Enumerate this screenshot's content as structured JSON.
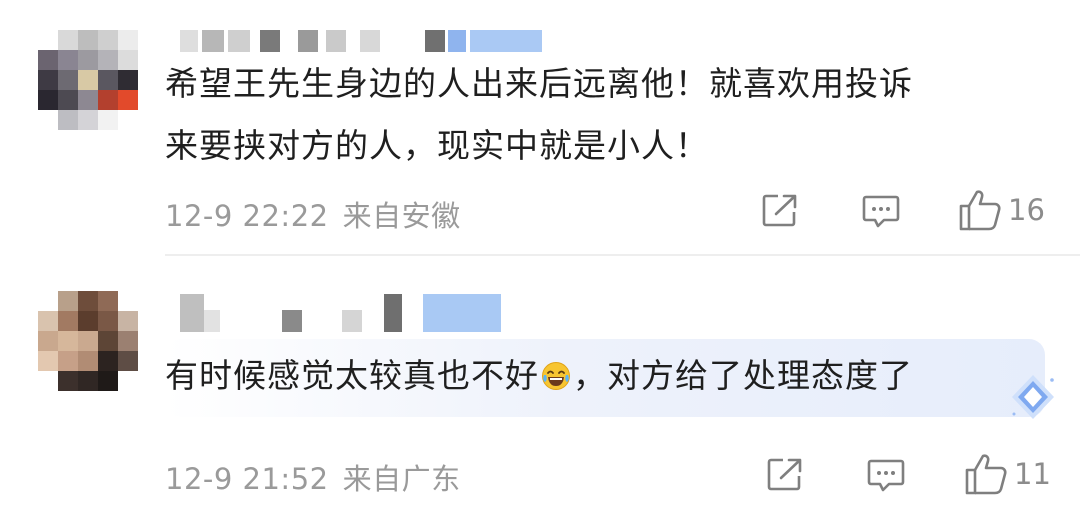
{
  "comments": [
    {
      "text_line1": "希望王先生身边的人出来后远离他！就喜欢用投诉",
      "text_line2": "来要挟对方的人，现实中就是小人！",
      "date": "12-9 22:22",
      "location": "来自安徽",
      "likes": "16",
      "share_icon": "share-icon",
      "comment_icon": "comment-icon",
      "like_icon": "thumbs-up-icon"
    },
    {
      "text_part1": "有时候感觉太较真也不好",
      "emoji": "laugh-cry-emoji",
      "text_part2": "，对方给了处理态度了",
      "date": "12-9 21:52",
      "location": "来自广东",
      "likes": "11",
      "share_icon": "share-icon",
      "comment_icon": "comment-icon",
      "like_icon": "thumbs-up-icon",
      "badge_icon": "diamond-badge-icon"
    }
  ],
  "colors": {
    "text": "#1f1f1f",
    "meta": "#9a9a9a",
    "icon": "#7f7f7f",
    "highlight": "#e6edfb",
    "username_blur": "#a9c9f4"
  }
}
